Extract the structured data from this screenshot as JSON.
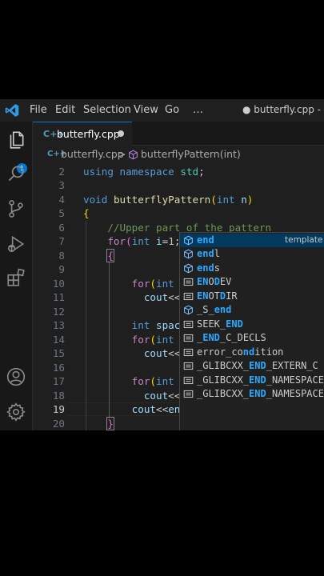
{
  "titlebar": {
    "menu": [
      "File",
      "Edit",
      "Selection",
      "View",
      "Go",
      "…"
    ],
    "window_title": "● butterfly.cpp - C+"
  },
  "activity": {
    "icons": [
      "files-icon",
      "search-icon",
      "source-control-icon",
      "run-debug-icon",
      "extensions-icon",
      "account-icon",
      "settings-gear-icon"
    ],
    "badge": "1"
  },
  "tab": {
    "label": "butterfly.cpp",
    "file_icon": "C++"
  },
  "breadcrumbs": {
    "file": "butterfly.cpp",
    "separator": ">",
    "symbol": "butterflyPattern(int)"
  },
  "editor": {
    "line_numbers": [
      "2",
      "3",
      "4",
      "5",
      "6",
      "7",
      "8",
      "9",
      "10",
      "11",
      "12",
      "13",
      "14",
      "15",
      "16",
      "17",
      "18",
      "19",
      "20"
    ],
    "current_line": "19"
  },
  "suggestions": [
    {
      "pre": "",
      "match": "end",
      "post": "",
      "detail": "template",
      "kind": "snippet"
    },
    {
      "pre": "",
      "match": "end",
      "post": "l",
      "detail": "",
      "kind": "snippet"
    },
    {
      "pre": "",
      "match": "end",
      "post": "s",
      "detail": "",
      "kind": "snippet"
    },
    {
      "pre": "",
      "match": "EN",
      "post": "O",
      "match2": "D",
      "post2": "EV",
      "detail": "",
      "kind": "enum"
    },
    {
      "pre": "",
      "match": "EN",
      "post": "OT",
      "match2": "D",
      "post2": "IR",
      "detail": "",
      "kind": "enum"
    },
    {
      "pre": "_S_",
      "match": "end",
      "post": "",
      "detail": "",
      "kind": "snippet"
    },
    {
      "pre": "SEEK_",
      "match": "END",
      "post": "",
      "detail": "",
      "kind": "enum"
    },
    {
      "pre": "_",
      "match": "END",
      "post": "_C_DECLS",
      "detail": "",
      "kind": "enum"
    },
    {
      "pre": "error_co",
      "match": "n",
      "post": "",
      "match2": "d",
      "post2": "ition",
      "detail": "",
      "kind": "enum"
    },
    {
      "pre": "_GLIBCXX_",
      "match": "END",
      "post": "_EXTERN_C",
      "detail": "",
      "kind": "enum"
    },
    {
      "pre": "_GLIBCXX_",
      "match": "END",
      "post": "_NAMESPACE_",
      "detail": "",
      "kind": "enum"
    },
    {
      "pre": "_GLIBCXX_",
      "match": "END",
      "post": "_NAMESPACE_",
      "detail": "",
      "kind": "enum"
    }
  ]
}
